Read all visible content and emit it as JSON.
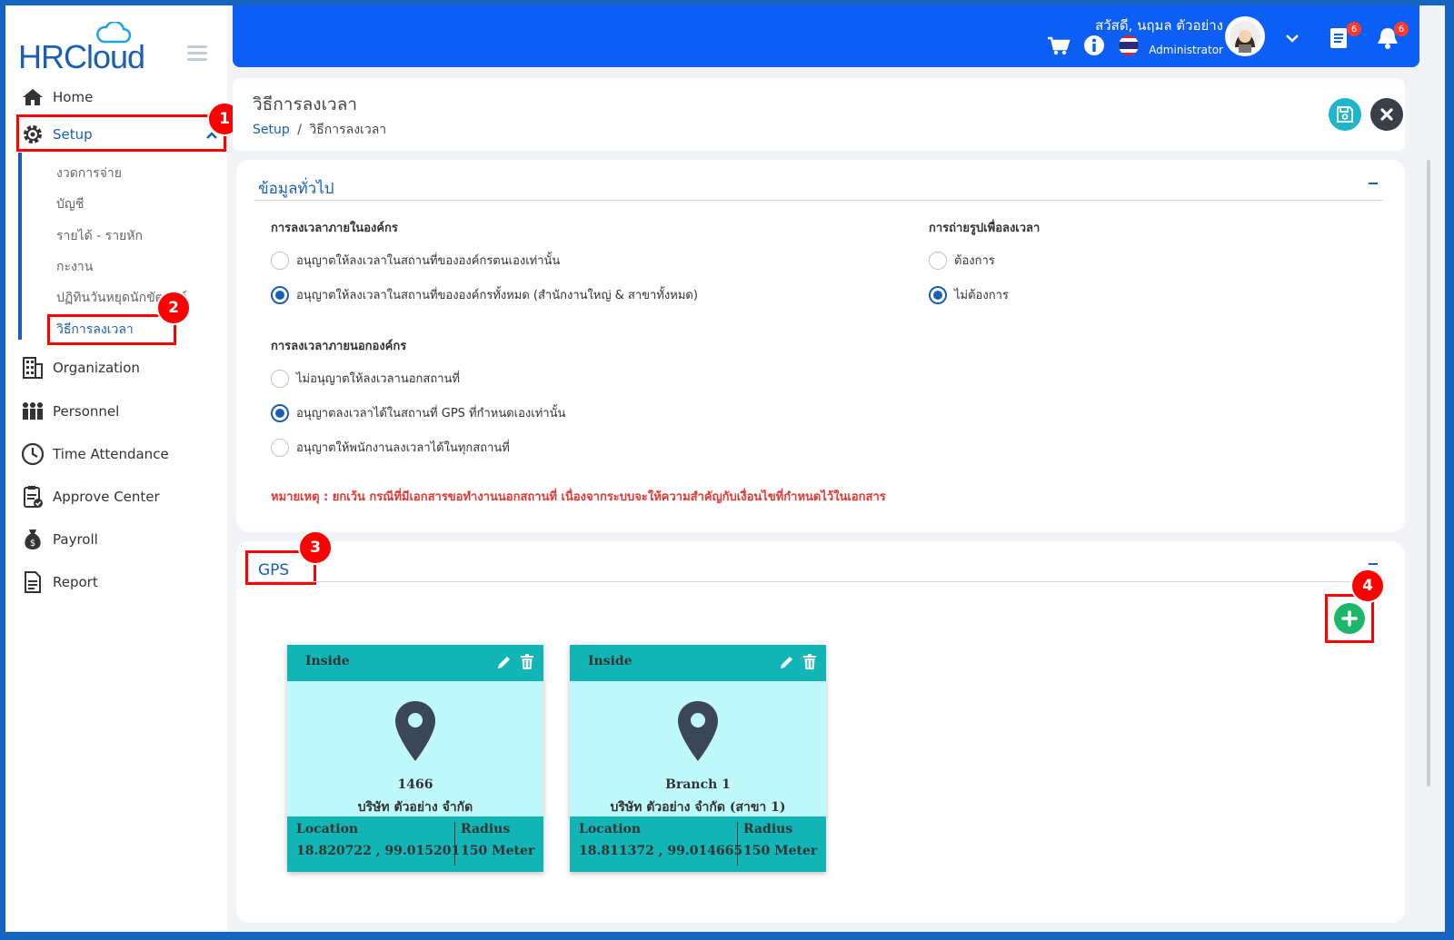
{
  "app": {
    "logo_text": "HRCloud"
  },
  "header": {
    "greeting": "สวัสดี, นฤมล ตัวอย่าง",
    "role": "Administrator",
    "doc_badge": "6",
    "bell_badge": "6"
  },
  "sidebar": {
    "items": [
      {
        "label": "Home"
      },
      {
        "label": "Setup"
      },
      {
        "label": "Organization"
      },
      {
        "label": "Personnel"
      },
      {
        "label": "Time Attendance"
      },
      {
        "label": "Approve Center"
      },
      {
        "label": "Payroll"
      },
      {
        "label": "Report"
      }
    ],
    "setup_sub": [
      {
        "label": "งวดการจ่าย"
      },
      {
        "label": "บัญชี"
      },
      {
        "label": "รายได้ - รายหัก"
      },
      {
        "label": "กะงาน"
      },
      {
        "label": "ปฏิทินวันหยุดนักขัตฤกษ์"
      },
      {
        "label": "วิธีการลงเวลา"
      }
    ]
  },
  "page": {
    "title": "วิธีการลงเวลา",
    "breadcrumb_root": "Setup",
    "breadcrumb_sep": "/",
    "breadcrumb_current": "วิธีการลงเวลา"
  },
  "general": {
    "title": "ข้อมูลทั่วไป",
    "inside_title": "การลงเวลาภายในองค์กร",
    "inside_options": [
      {
        "label": "อนุญาตให้ลงเวลาในสถานที่ขององค์กรตนเองเท่านั้น",
        "selected": false
      },
      {
        "label": "อนุญาตให้ลงเวลาในสถานที่ขององค์กรทั้งหมด (สำนักงานใหญ่ & สาขาทั้งหมด)",
        "selected": true
      }
    ],
    "photo_title": "การถ่ายรูปเพื่อลงเวลา",
    "photo_options": [
      {
        "label": "ต้องการ",
        "selected": false
      },
      {
        "label": "ไม่ต้องการ",
        "selected": true
      }
    ],
    "outside_title": "การลงเวลาภายนอกองค์กร",
    "outside_options": [
      {
        "label": "ไม่อนุญาตให้ลงเวลานอกสถานที่",
        "selected": false
      },
      {
        "label": "อนุญาตลงเวลาได้ในสถานที่ GPS ที่กำหนดเองเท่านั้น",
        "selected": true
      },
      {
        "label": "อนุญาตให้พนักงานลงเวลาได้ในทุกสถานที่",
        "selected": false
      }
    ],
    "note": "หมายเหตุ : ยกเว้น กรณีที่มีเอกสารขอทำงานนอกสถานที่ เนื่องจากระบบจะให้ความสำคัญกับเงื่อนไขที่กำหนดไว้ในเอกสาร"
  },
  "gps": {
    "title": "GPS",
    "locations": [
      {
        "type": "Inside",
        "name": "1466",
        "company": "บริษัท ตัวอย่าง จำกัด",
        "location_label": "Location",
        "location": "18.820722 , 99.015201",
        "radius_label": "Radius",
        "radius": "150 Meter"
      },
      {
        "type": "Inside",
        "name": "Branch 1",
        "company": "บริษัท ตัวอย่าง จำกัด (สาขา 1)",
        "location_label": "Location",
        "location": "18.811372 , 99.014665",
        "radius_label": "Radius",
        "radius": "150 Meter"
      }
    ]
  },
  "annotations": [
    "1",
    "2",
    "3",
    "4"
  ],
  "colors": {
    "primary": "#0d5ef5",
    "accent": "#1a5fb4",
    "teal": "#12b5b5",
    "card_bg": "#bff9fb",
    "highlight": "#ff0000",
    "add": "#1cb86a"
  }
}
